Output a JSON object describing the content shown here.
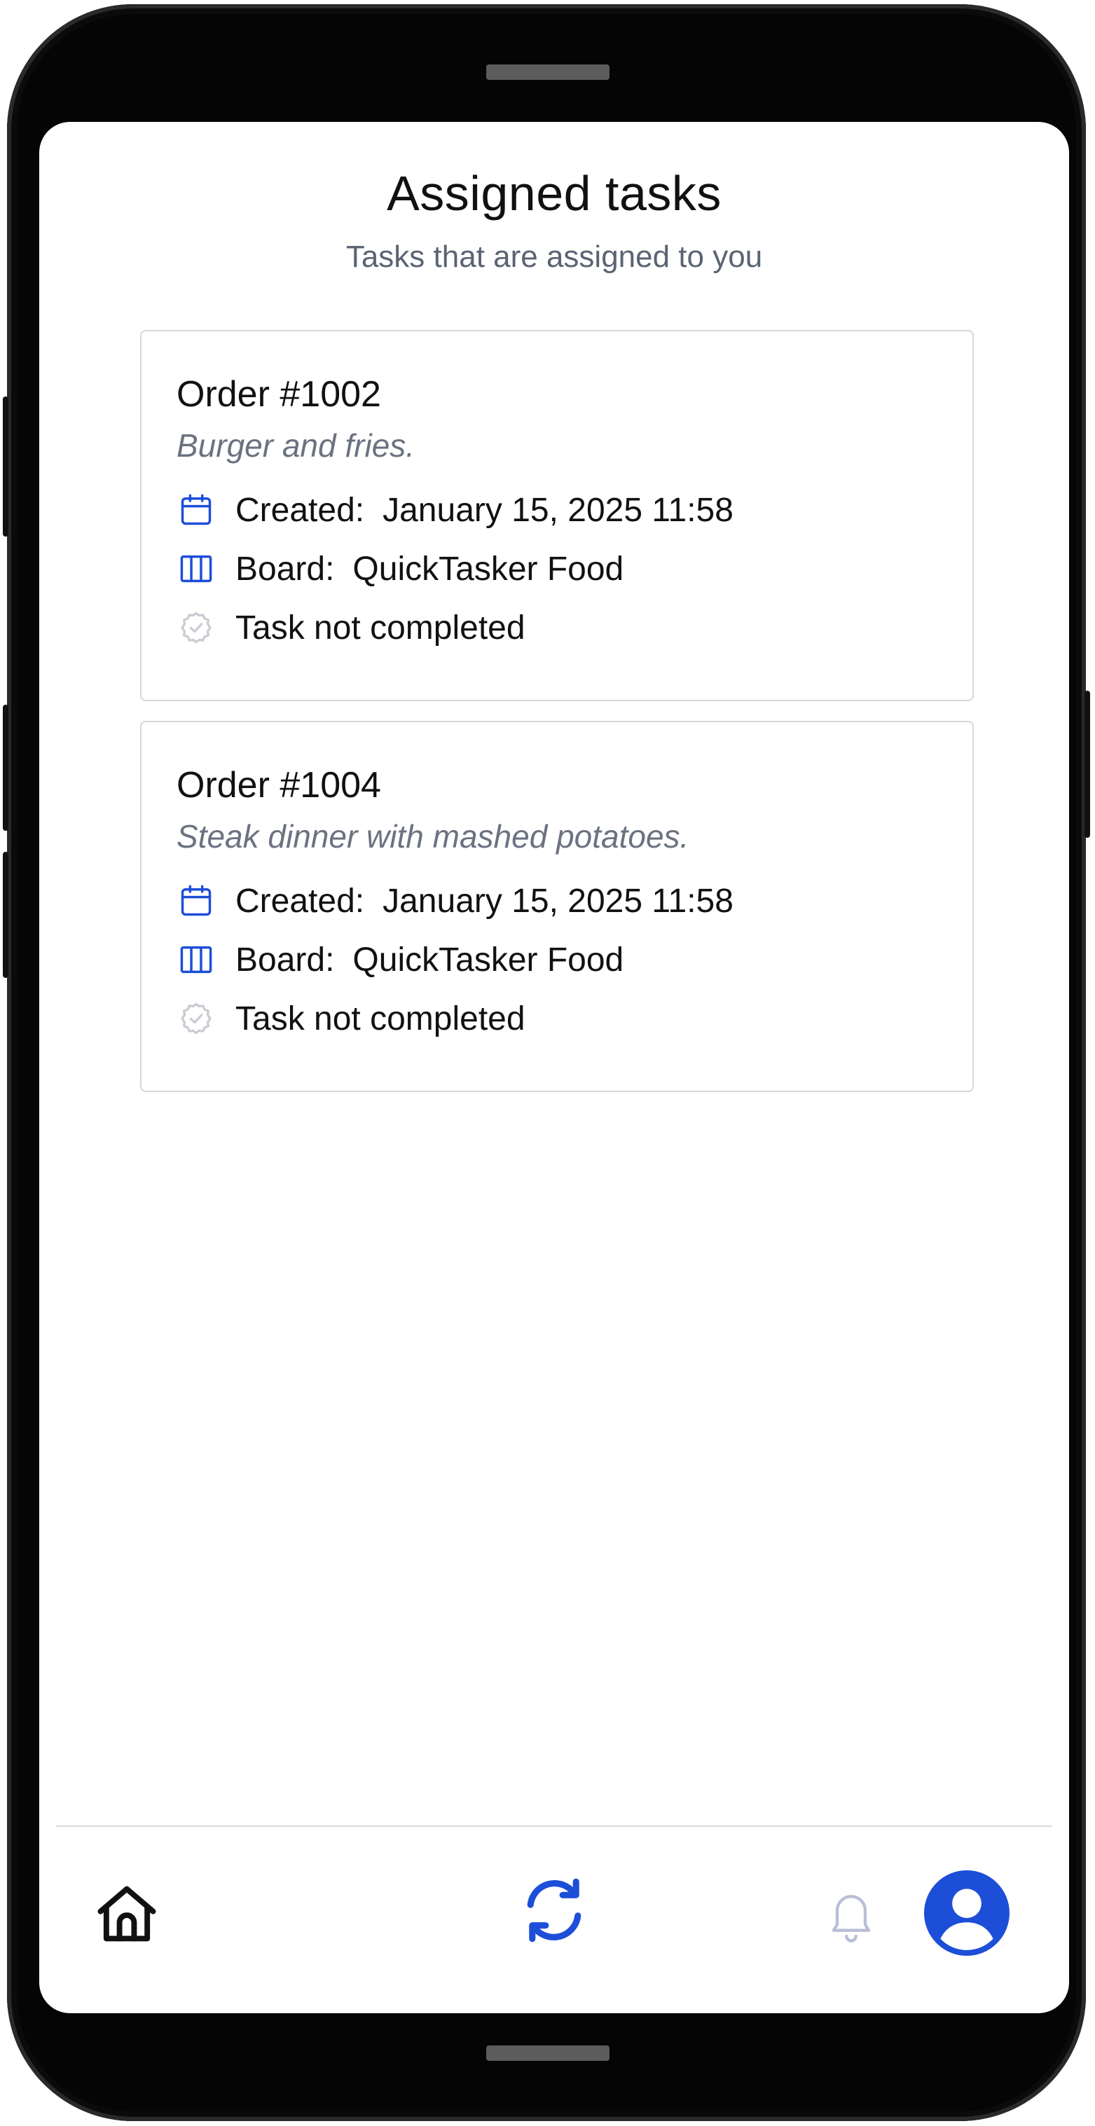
{
  "header": {
    "title": "Assigned tasks",
    "subtitle": "Tasks that are assigned to you"
  },
  "tasks": [
    {
      "title": "Order #1002",
      "description": "Burger and fries.",
      "created_label": "Created:",
      "created_value": "January 15, 2025 11:58",
      "board_label": "Board:",
      "board_value": "QuickTasker Food",
      "status": "Task not completed"
    },
    {
      "title": "Order #1004",
      "description": "Steak dinner with mashed potatoes.",
      "created_label": "Created:",
      "created_value": "January 15, 2025 11:58",
      "board_label": "Board:",
      "board_value": "QuickTasker Food",
      "status": "Task not completed"
    }
  ],
  "icons": {
    "created": "calendar-icon",
    "board": "columns-icon",
    "status": "check-circle-icon"
  },
  "bottom_nav": {
    "items": [
      {
        "icon": "home-icon"
      },
      {
        "icon": "refresh-icon"
      },
      {
        "icon": "bell-icon"
      },
      {
        "icon": "user-avatar-icon"
      }
    ]
  },
  "colors": {
    "accent": "#1d4ed8",
    "muted_text": "#6b7280",
    "border": "#d3d7dd"
  }
}
